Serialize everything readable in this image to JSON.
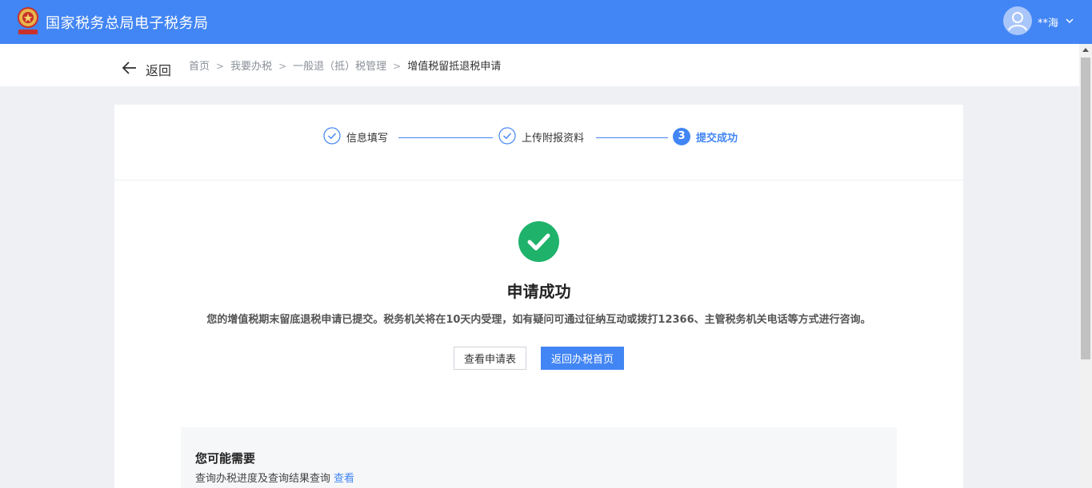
{
  "header": {
    "title": "国家税务总局电子税务局",
    "emblem_text": "税徽",
    "user_name": "**海"
  },
  "nav": {
    "back_label": "返回",
    "breadcrumb": [
      "首页",
      "我要办税",
      "一般退（抵）税管理",
      "增值税留抵退税申请"
    ]
  },
  "steps": [
    {
      "label": "信息填写",
      "status": "done"
    },
    {
      "label": "上传附报资料",
      "status": "done"
    },
    {
      "number": "3",
      "label": "提交成功",
      "status": "active"
    }
  ],
  "result": {
    "title": "申请成功",
    "description": "您的增值税期末留底退税申请已提交。税务机关将在10天内受理，如有疑问可通过征纳互动或拨打12366、主管税务机关电话等方式进行咨询。",
    "view_button": "查看申请表",
    "home_button": "返回办税首页"
  },
  "maybe": {
    "title": "您可能需要",
    "text": "查询办税进度及查询结果查询",
    "link": "查看"
  },
  "colors": {
    "brand": "#4285f4",
    "success": "#1fb26b",
    "background": "#eef0f4"
  },
  "icons": [
    "tax-emblem-icon",
    "user-avatar-icon",
    "chevron-down-icon",
    "arrow-left-icon",
    "check-circle-icon",
    "success-check-icon"
  ]
}
